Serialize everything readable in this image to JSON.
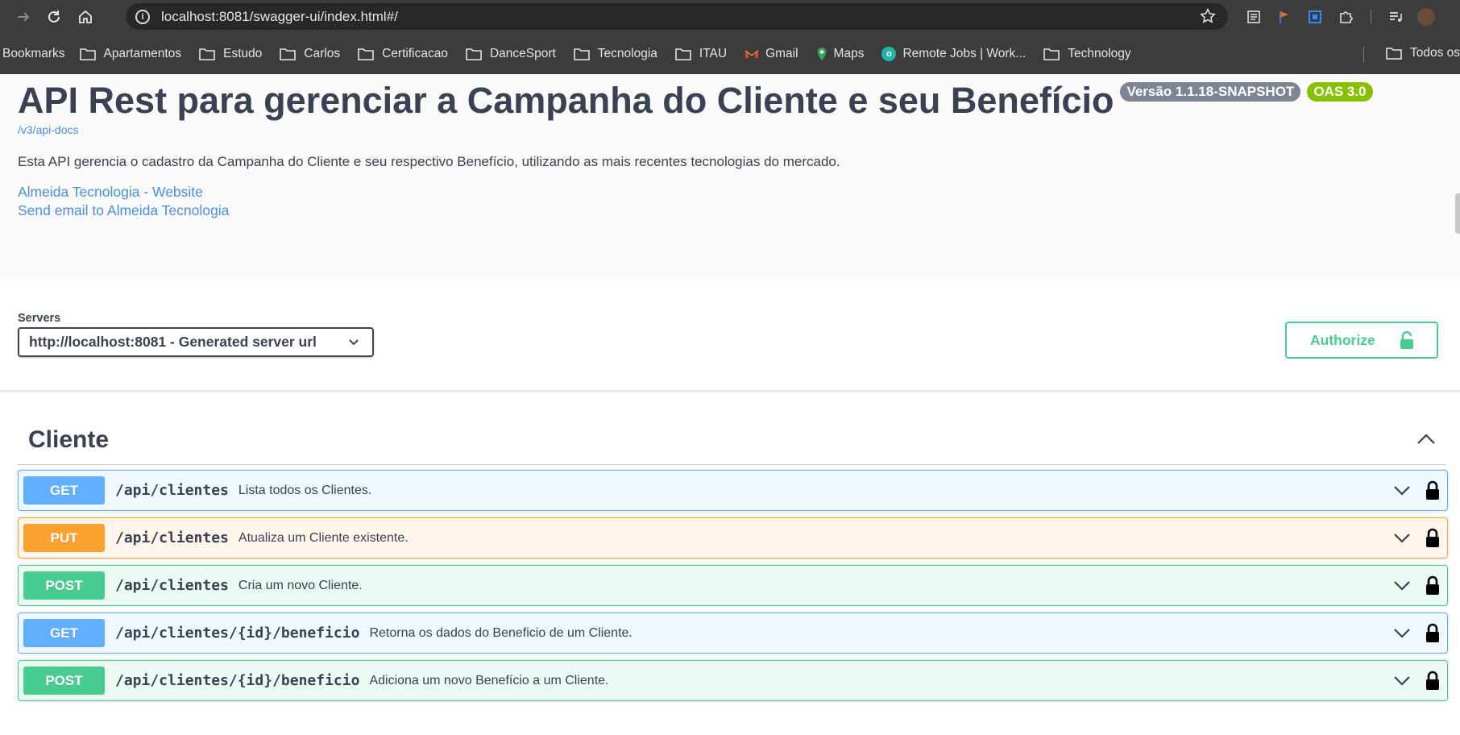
{
  "browser": {
    "url": "localhost:8081/swagger-ui/index.html#/",
    "bookmarks": [
      {
        "label": "Bookmarks",
        "icon": "none"
      },
      {
        "label": "Apartamentos",
        "icon": "folder-icon"
      },
      {
        "label": "Estudo",
        "icon": "folder-icon"
      },
      {
        "label": "Carlos",
        "icon": "folder-icon"
      },
      {
        "label": "Certificacao",
        "icon": "folder-icon"
      },
      {
        "label": "DanceSport",
        "icon": "folder-icon"
      },
      {
        "label": "Tecnologia",
        "icon": "folder-icon"
      },
      {
        "label": "ITAU",
        "icon": "folder-icon"
      },
      {
        "label": "Gmail",
        "icon": "gmail-icon"
      },
      {
        "label": "Maps",
        "icon": "maps-icon"
      },
      {
        "label": "Remote Jobs | Work...",
        "icon": "remote-jobs-icon"
      },
      {
        "label": "Technology",
        "icon": "folder-icon"
      }
    ],
    "all_bookmarks_label": "Todos os fa"
  },
  "info": {
    "title": "API Rest para gerenciar a Campanha do Cliente e seu Benefício",
    "version_badge": "Versão 1.1.18-SNAPSHOT",
    "oas_badge": "OAS 3.0",
    "docs_link": "/v3/api-docs",
    "description": "Esta API gerencia o cadastro da Campanha do Cliente e seu respectivo Benefício, utilizando as mais recentes tecnologias do mercado.",
    "website_link": "Almeida Tecnologia - Website",
    "email_link": "Send email to Almeida Tecnologia"
  },
  "servers": {
    "label": "Servers",
    "selected": "http://localhost:8081 - Generated server url"
  },
  "authorize": {
    "label": "Authorize"
  },
  "tag": {
    "name": "Cliente"
  },
  "operations": [
    {
      "method": "GET",
      "path": "/api/clientes",
      "summary": "Lista todos os Clientes."
    },
    {
      "method": "PUT",
      "path": "/api/clientes",
      "summary": "Atualiza um Cliente existente."
    },
    {
      "method": "POST",
      "path": "/api/clientes",
      "summary": "Cria um novo Cliente."
    },
    {
      "method": "GET",
      "path": "/api/clientes/{id}/beneficio",
      "summary": "Retorna os dados do Beneficio de um Cliente."
    },
    {
      "method": "POST",
      "path": "/api/clientes/{id}/beneficio",
      "summary": "Adiciona um novo Benefício a um Cliente."
    }
  ],
  "colors": {
    "get": "#61affe",
    "put": "#fca130",
    "post": "#49cc90",
    "link": "#4990e2",
    "text": "#3b4151"
  }
}
